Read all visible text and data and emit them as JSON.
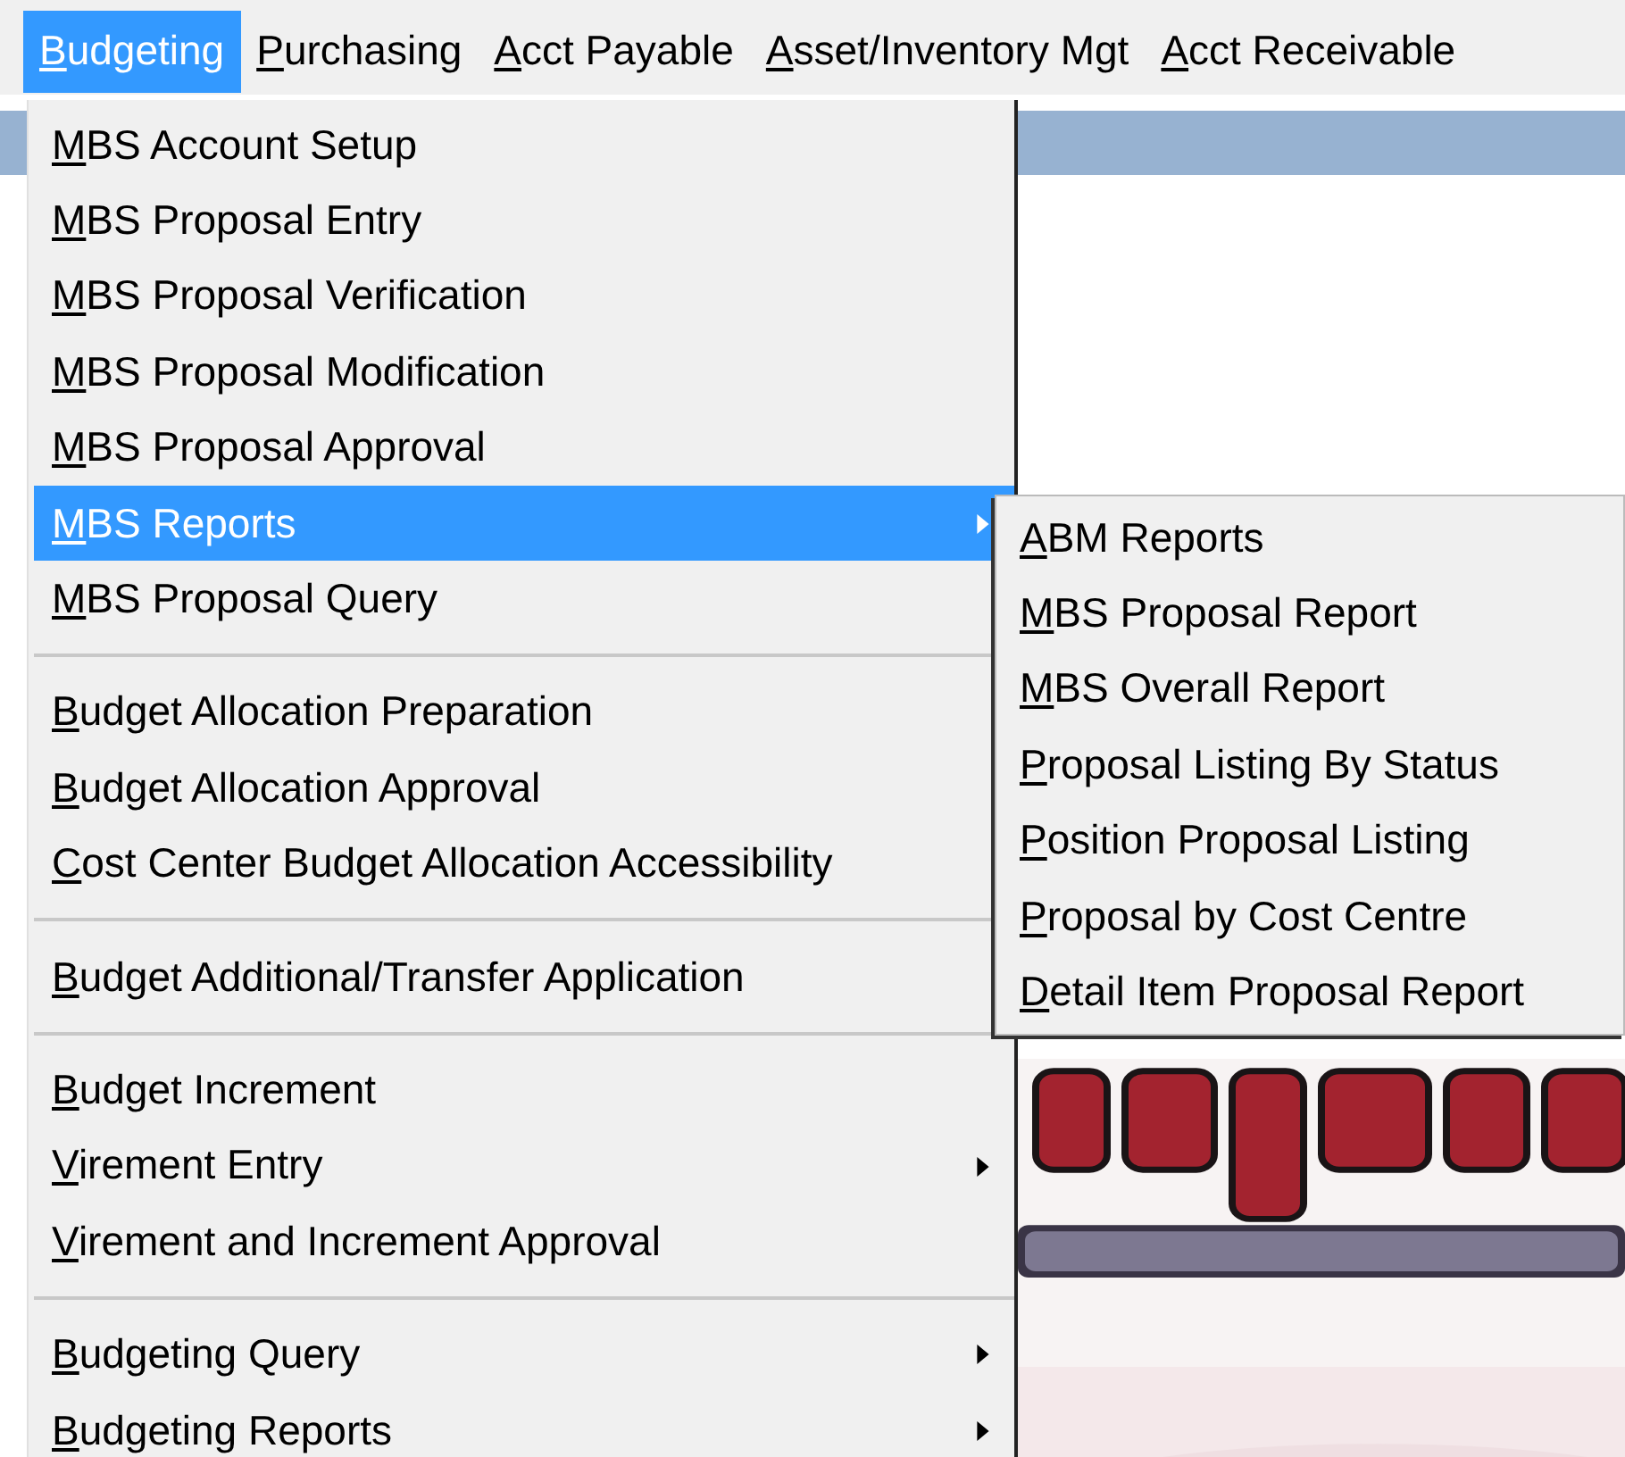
{
  "menu_bar": [
    {
      "label": "Budgeting",
      "selected": true
    },
    {
      "label": "Purchasing",
      "selected": false
    },
    {
      "label": "Acct Payable",
      "selected": false
    },
    {
      "label": "Asset/Inventory Mgt",
      "selected": false
    },
    {
      "label": "Acct Receivable",
      "selected": false
    }
  ],
  "menu": [
    {
      "kind": "item",
      "label": "MBS Account Setup",
      "submenu": false,
      "selected": false
    },
    {
      "kind": "item",
      "label": "MBS Proposal Entry",
      "submenu": false,
      "selected": false
    },
    {
      "kind": "item",
      "label": "MBS Proposal Verification",
      "submenu": false,
      "selected": false
    },
    {
      "kind": "item",
      "label": "MBS Proposal Modification",
      "submenu": false,
      "selected": false
    },
    {
      "kind": "item",
      "label": "MBS Proposal Approval",
      "submenu": false,
      "selected": false
    },
    {
      "kind": "item",
      "label": "MBS Reports",
      "submenu": true,
      "selected": true
    },
    {
      "kind": "item",
      "label": "MBS Proposal Query",
      "submenu": false,
      "selected": false
    },
    {
      "kind": "separator"
    },
    {
      "kind": "item",
      "label": "Budget Allocation Preparation",
      "submenu": false,
      "selected": false
    },
    {
      "kind": "item",
      "label": "Budget Allocation Approval",
      "submenu": false,
      "selected": false
    },
    {
      "kind": "item",
      "label": "Cost Center Budget Allocation Accessibility",
      "submenu": false,
      "selected": false
    },
    {
      "kind": "separator"
    },
    {
      "kind": "item",
      "label": "Budget Additional/Transfer Application",
      "submenu": false,
      "selected": false
    },
    {
      "kind": "separator"
    },
    {
      "kind": "item",
      "label": "Budget Increment",
      "submenu": false,
      "selected": false
    },
    {
      "kind": "item",
      "label": "Virement Entry",
      "submenu": true,
      "selected": false
    },
    {
      "kind": "item",
      "label": "Virement and Increment Approval",
      "submenu": false,
      "selected": false
    },
    {
      "kind": "separator"
    },
    {
      "kind": "item",
      "label": "Budgeting Query",
      "submenu": true,
      "selected": false
    },
    {
      "kind": "item",
      "label": "Budgeting Reports",
      "submenu": true,
      "selected": false
    }
  ],
  "submenu": [
    {
      "label": "ABM Reports",
      "selected": false
    },
    {
      "label": "MBS Proposal Report",
      "selected": false
    },
    {
      "label": "MBS Overall Report",
      "selected": false
    },
    {
      "label": "Proposal Listing By Status",
      "selected": false
    },
    {
      "label": "Position Proposal Listing",
      "selected": false
    },
    {
      "label": "Proposal by Cost Centre",
      "selected": false
    },
    {
      "label": "Detail Item Proposal Report",
      "selected": false
    }
  ]
}
